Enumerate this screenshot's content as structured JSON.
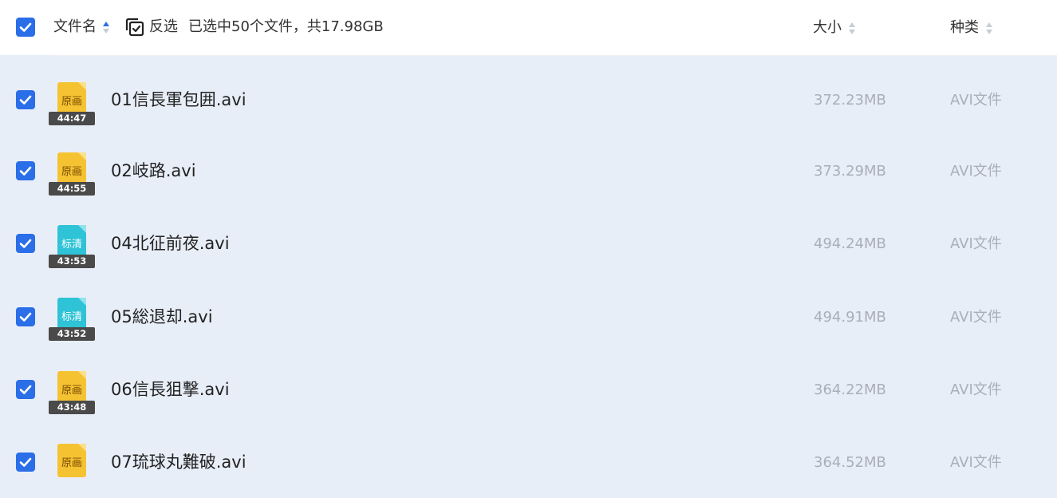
{
  "header": {
    "col_name": "文件名",
    "invert_label": "反选",
    "selection_summary": "已选中50个文件，共17.98GB",
    "col_size": "大小",
    "col_type": "种类"
  },
  "colors": {
    "accent": "#2a6ee8",
    "row_bg": "#e8eef8",
    "original_thumb": "#f5c332",
    "sd_thumb": "#2ec3d6"
  },
  "files": [
    {
      "name": "01信長軍包囲.avi",
      "size": "372.23MB",
      "type": "AVI文件",
      "quality": "原画",
      "duration": "44:47",
      "thumb": "original"
    },
    {
      "name": "02岐路.avi",
      "size": "373.29MB",
      "type": "AVI文件",
      "quality": "原画",
      "duration": "44:55",
      "thumb": "original"
    },
    {
      "name": "04北征前夜.avi",
      "size": "494.24MB",
      "type": "AVI文件",
      "quality": "标清",
      "duration": "43:53",
      "thumb": "sd"
    },
    {
      "name": "05総退却.avi",
      "size": "494.91MB",
      "type": "AVI文件",
      "quality": "标清",
      "duration": "43:52",
      "thumb": "sd"
    },
    {
      "name": "06信長狙撃.avi",
      "size": "364.22MB",
      "type": "AVI文件",
      "quality": "原画",
      "duration": "43:48",
      "thumb": "original"
    },
    {
      "name": "07琉球丸難破.avi",
      "size": "364.52MB",
      "type": "AVI文件",
      "quality": "原画",
      "duration": "",
      "thumb": "original"
    }
  ]
}
